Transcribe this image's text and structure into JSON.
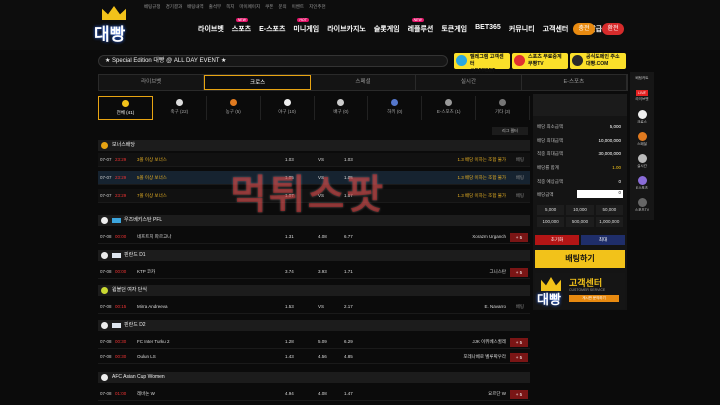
{
  "logo_text": "대빵",
  "top_links": [
    "베팅규정",
    "경기결과",
    "배팅내역",
    "출석부",
    "쪽지",
    "마이페이지",
    "쿠폰",
    "문의",
    "이벤트",
    "지인추천"
  ],
  "main_nav": [
    {
      "label": "라이브벳",
      "badge": ""
    },
    {
      "label": "스포츠",
      "badge": "NEW"
    },
    {
      "label": "E-스포츠",
      "badge": ""
    },
    {
      "label": "미니게임",
      "badge": "HOT"
    },
    {
      "label": "라이브카지노",
      "badge": ""
    },
    {
      "label": "슬롯게임",
      "badge": ""
    },
    {
      "label": "레플루션",
      "badge": "NEW"
    },
    {
      "label": "토큰게임",
      "badge": ""
    },
    {
      "label": "BET365",
      "badge": ""
    },
    {
      "label": "커뮤니티",
      "badge": ""
    },
    {
      "label": "고객센터",
      "badge": ""
    },
    {
      "label": "계좌발급",
      "badge": ""
    }
  ],
  "header_buttons": {
    "charge": "충전",
    "withdraw": "환전"
  },
  "announcement": "★ Special Edition 대빵 @ ALL DAY EVENT ★",
  "promos": [
    {
      "line1": "텔레그램 고객센터",
      "line2": "@DPPBET"
    },
    {
      "line1": "스포츠 무료중계",
      "line2": "무빵TV"
    },
    {
      "line1": "공식도메인 주소",
      "line2": "대빵.COM"
    }
  ],
  "sport_tabs": [
    "라이브벳",
    "크로스",
    "스페셜",
    "실시간",
    "E-스포츠"
  ],
  "active_sport_tab": 1,
  "categories": [
    "전체 (41)",
    "축구 (22)",
    "농구 (5)",
    "야구 (10)",
    "배구 (0)",
    "하키 (0)",
    "E-스포츠 (1)",
    "기타 (3)"
  ],
  "league_filter": "리그 필터",
  "bonus_section": "보너스배당",
  "bonus_rows": [
    {
      "date": "07-07",
      "time": "23:29",
      "home": "3폴 이상 보너스",
      "ho": "1.03",
      "vs": "VS",
      "ao": "1.03",
      "away": "1.3 배당 이하는 조합 불가",
      "bet": "배팅"
    },
    {
      "date": "07-07",
      "time": "23:29",
      "home": "5폴 이상 보너스",
      "ho": "1.05",
      "vs": "VS",
      "ao": "1.05",
      "away": "1.3 배당 이하는 조합 불가",
      "bet": "배팅"
    },
    {
      "date": "07-07",
      "time": "23:29",
      "home": "7폴 이상 보너스",
      "ho": "1.07",
      "vs": "VS",
      "ao": "1.07",
      "away": "1.3 배당 이하는 조합 불가",
      "bet": "배팅"
    }
  ],
  "sections": [
    {
      "name": "우즈베키스탄 PFL",
      "rows": [
        {
          "date": "07-08",
          "time": "00:00",
          "home": "네프트치 파르고나",
          "ho": "1.31",
          "vs": "4.08",
          "ao": "6.77",
          "away": "Xorazm Urganch",
          "plus": "+ 5"
        }
      ]
    },
    {
      "name": "핀란드 D1",
      "rows": [
        {
          "date": "07-08",
          "time": "00:00",
          "home": "KTP 코카",
          "ho": "3.74",
          "vs": "3.93",
          "ao": "1.71",
          "away": "그니스탄",
          "plus": "+ 5"
        }
      ]
    },
    {
      "name": "윔블던 여자 단식",
      "rows": [
        {
          "date": "07-08",
          "time": "00:15",
          "home": "Mirra Andreeva",
          "ho": "1.53",
          "vs": "VS",
          "ao": "2.17",
          "away": "E. Navarro",
          "bet": "배팅"
        }
      ]
    },
    {
      "name": "핀란드 D2",
      "rows": [
        {
          "date": "07-08",
          "time": "00:30",
          "home": "FC Inter Turku 2",
          "ho": "1.28",
          "vs": "5.09",
          "ao": "6.29",
          "away": "JJK 이뷔베스퀼레",
          "plus": "+ 5"
        },
        {
          "date": "07-08",
          "time": "00:30",
          "home": "Oulun LS",
          "ho": "1.43",
          "vs": "4.56",
          "ao": "4.85",
          "away": "포레나베로 벨루짜우라",
          "plus": "+ 5"
        }
      ]
    },
    {
      "name": "AFC Asian Cup Women",
      "rows": [
        {
          "date": "07-08",
          "time": "01:00",
          "home": "레바논 W",
          "ho": "4.94",
          "vs": "4.08",
          "ao": "1.47",
          "away": "요르단 W",
          "plus": "+ 5"
        }
      ]
    }
  ],
  "watermark": "먹튀스팟",
  "betslip": {
    "lines": [
      {
        "label": "배당 최소금액",
        "value": "5,000"
      },
      {
        "label": "배당 최대금액",
        "value": "10,000,000"
      },
      {
        "label": "적중 최대금액",
        "value": "30,000,000"
      },
      {
        "label": "배당률 합계",
        "value": "1.00"
      },
      {
        "label": "적중 예상금액",
        "value": "0"
      },
      {
        "label": "배당금액",
        "value": "0"
      }
    ],
    "chips_row1": [
      "5,000",
      "10,000",
      "50,000"
    ],
    "chips_row2": [
      "100,000",
      "500,000",
      "1,000,000"
    ],
    "reset": "초기화",
    "delete": "최대",
    "bet_button": "배팅하기"
  },
  "customer_service": {
    "title": "고객센터",
    "subtitle": "CUSTOMER SERVICE",
    "button": "게시판 문의하기"
  },
  "right_bar": [
    {
      "label": "배팅카트",
      "icon": "cart-icon"
    },
    {
      "label": "라이브벳",
      "icon": "live-icon"
    },
    {
      "label": "크로스",
      "icon": "soccer-icon"
    },
    {
      "label": "스페셜",
      "icon": "basketball-icon"
    },
    {
      "label": "실시간",
      "icon": "realtime-icon"
    },
    {
      "label": "E스포츠",
      "icon": "esports-icon"
    },
    {
      "label": "스포츠TV",
      "icon": "tv-icon"
    }
  ]
}
